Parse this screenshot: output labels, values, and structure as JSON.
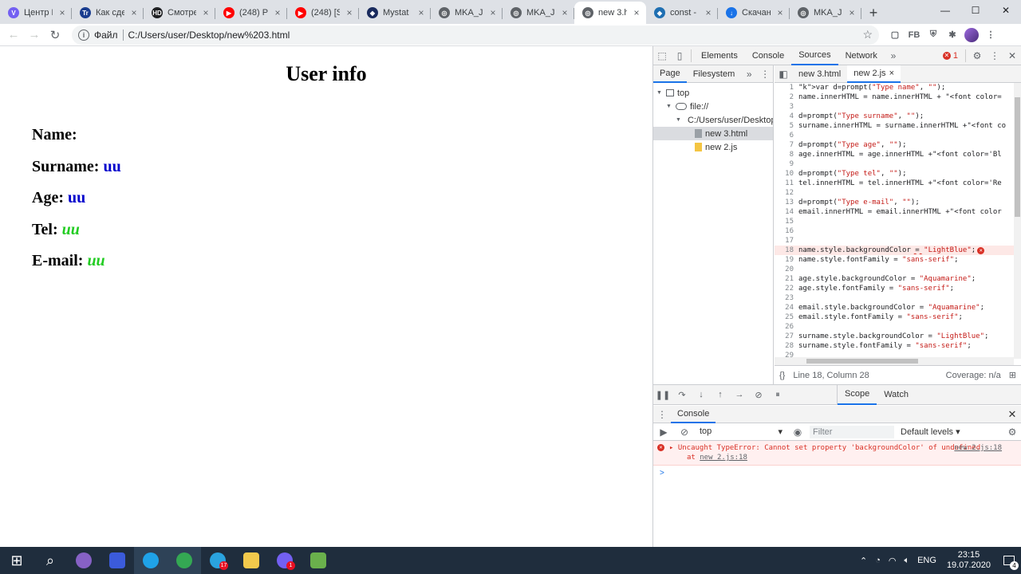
{
  "browser": {
    "tabs": [
      {
        "title": "Центр П",
        "fav": "V",
        "fav_color": "#7360f2"
      },
      {
        "title": "Как сде",
        "fav": "Tr",
        "fav_color": "#1a3d8f"
      },
      {
        "title": "Смотре",
        "fav": "HD",
        "fav_color": "#202124"
      },
      {
        "title": "(248) Ре",
        "fav": "▶",
        "fav_color": "#ff0000"
      },
      {
        "title": "(248) [St",
        "fav": "▶",
        "fav_color": "#ff0000"
      },
      {
        "title": "Mystat",
        "fav": "◆",
        "fav_color": "#1a2b5e"
      },
      {
        "title": "MKA_JS_",
        "fav": "◎",
        "fav_color": "#5f6368"
      },
      {
        "title": "MKA_JS_",
        "fav": "◎",
        "fav_color": "#5f6368"
      },
      {
        "title": "new 3.ht",
        "fav": "◎",
        "fav_color": "#5f6368",
        "active": true
      },
      {
        "title": "const - J",
        "fav": "◆",
        "fav_color": "#1f6fb2"
      },
      {
        "title": "Скачани",
        "fav": "↓",
        "fav_color": "#1a73e8"
      },
      {
        "title": "MKA_JS_",
        "fav": "◎",
        "fav_color": "#5f6368"
      }
    ],
    "new_tab": "+",
    "window_controls": {
      "minimize": "—",
      "maximize": "☐",
      "close": "✕"
    },
    "back": "←",
    "forward": "→",
    "reload": "↻",
    "address_label": "Файл",
    "url": "C:/Users/user/Desktop/new%203.html",
    "extension_fb": "FB"
  },
  "page": {
    "title": "User info",
    "fields": [
      {
        "label": "Name:",
        "value": "",
        "color": "#0000cc",
        "italic": false
      },
      {
        "label": "Surname:",
        "value": "uu",
        "color": "#0000cc",
        "italic": false
      },
      {
        "label": "Age:",
        "value": "uu",
        "color": "#0000cc",
        "italic": false
      },
      {
        "label": "Tel:",
        "value": "uu",
        "color": "#22cc22",
        "italic": true
      },
      {
        "label": "E-mail:",
        "value": "uu",
        "color": "#22cc22",
        "italic": true
      }
    ]
  },
  "devtools": {
    "tabs": [
      "Elements",
      "Console",
      "Sources",
      "Network"
    ],
    "active_tab": "Sources",
    "more": "»",
    "error_count": "1",
    "navigator_tabs": [
      "Page",
      "Filesystem"
    ],
    "tree": [
      {
        "label": "top",
        "depth": 0,
        "icon": "box"
      },
      {
        "label": "file://",
        "depth": 1,
        "icon": "cloud"
      },
      {
        "label": "C:/Users/user/Desktop",
        "depth": 2,
        "icon": "folder"
      },
      {
        "label": "new 3.html",
        "depth": 3,
        "icon": "html",
        "selected": true
      },
      {
        "label": "new 2.js",
        "depth": 3,
        "icon": "js"
      }
    ],
    "editor_tabs": [
      {
        "label": "new 3.html",
        "active": false
      },
      {
        "label": "new 2.js",
        "active": true,
        "close": "×"
      }
    ],
    "code_lines": [
      {
        "n": "1",
        "text": "var d=prompt(\"Type name\", \"\");"
      },
      {
        "n": "2",
        "text": "name.innerHTML = name.innerHTML + \"<font color="
      },
      {
        "n": "3",
        "text": ""
      },
      {
        "n": "4",
        "text": "d=prompt(\"Type surname\", \"\");"
      },
      {
        "n": "5",
        "text": "surname.innerHTML = surname.innerHTML +\"<font co"
      },
      {
        "n": "6",
        "text": ""
      },
      {
        "n": "7",
        "text": "d=prompt(\"Type age\", \"\");"
      },
      {
        "n": "8",
        "text": "age.innerHTML = age.innerHTML +\"<font color='Bl"
      },
      {
        "n": "9",
        "text": ""
      },
      {
        "n": "10",
        "text": "d=prompt(\"Type tel\", \"\");"
      },
      {
        "n": "11",
        "text": "tel.innerHTML = tel.innerHTML +\"<font color='Re"
      },
      {
        "n": "12",
        "text": ""
      },
      {
        "n": "13",
        "text": "d=prompt(\"Type e-mail\", \"\");"
      },
      {
        "n": "14",
        "text": "email.innerHTML = email.innerHTML +\"<font color"
      },
      {
        "n": "15",
        "text": ""
      },
      {
        "n": "16",
        "text": ""
      },
      {
        "n": "17",
        "text": ""
      },
      {
        "n": "18",
        "text": "name.style.backgroundColor = \"LightBlue\";",
        "error": true
      },
      {
        "n": "19",
        "text": "name.style.fontFamily = \"sans-serif\";"
      },
      {
        "n": "20",
        "text": ""
      },
      {
        "n": "21",
        "text": "age.style.backgroundColor = \"Aquamarine\";"
      },
      {
        "n": "22",
        "text": "age.style.fontFamily = \"sans-serif\";"
      },
      {
        "n": "23",
        "text": ""
      },
      {
        "n": "24",
        "text": "email.style.backgroundColor = \"Aquamarine\";"
      },
      {
        "n": "25",
        "text": "email.style.fontFamily = \"sans-serif\";"
      },
      {
        "n": "26",
        "text": ""
      },
      {
        "n": "27",
        "text": "surname.style.backgroundColor = \"LightBlue\";"
      },
      {
        "n": "28",
        "text": "surname.style.fontFamily = \"sans-serif\";"
      },
      {
        "n": "29",
        "text": ""
      }
    ],
    "status": {
      "braces": "{}",
      "position": "Line 18, Column 28",
      "coverage": "Coverage: n/a"
    },
    "scope_tabs": [
      "Scope",
      "Watch"
    ],
    "drawer_tab": "Console",
    "console": {
      "context": "top",
      "filter_placeholder": "Filter",
      "levels": "Default levels ▾",
      "error_message": "Uncaught TypeError: Cannot set property 'backgroundColor' of undefined",
      "error_at": "at",
      "error_link": "new 2.js:18",
      "prompt": ">"
    }
  },
  "taskbar": {
    "apps": [
      {
        "name": "start",
        "color": "#ffffff"
      },
      {
        "name": "search",
        "color": "#ffffff"
      },
      {
        "name": "cortana",
        "color": "#8661c5"
      },
      {
        "name": "notes",
        "color": "#3b5bdb"
      },
      {
        "name": "edge",
        "color": "#1fa2e8",
        "active": true
      },
      {
        "name": "chrome",
        "color": "#34a853",
        "active": true
      },
      {
        "name": "telegram",
        "color": "#2aa3df",
        "badge": "17"
      },
      {
        "name": "explorer",
        "color": "#f2c94c"
      },
      {
        "name": "viber",
        "color": "#7360f2",
        "badge": "1"
      },
      {
        "name": "notepadpp",
        "color": "#6ab04c"
      }
    ],
    "language": "ENG",
    "time": "23:15",
    "date": "19.07.2020",
    "notifications": "4"
  }
}
